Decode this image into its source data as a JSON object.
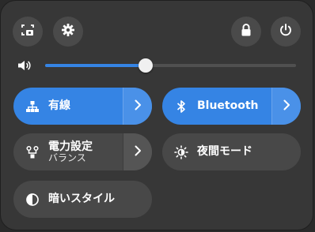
{
  "top_buttons": {
    "screenshot_icon": "screenshot-icon",
    "settings_icon": "gear-icon",
    "lock_icon": "lock-icon",
    "power_icon": "power-icon"
  },
  "volume": {
    "icon": "speaker-icon",
    "level_percent": 40
  },
  "tiles": {
    "network": {
      "label": "有線",
      "active": true,
      "icon": "network-wired-icon"
    },
    "bluetooth": {
      "label": "Bluetooth",
      "active": true,
      "icon": "bluetooth-icon"
    },
    "power_mode": {
      "label": "電力設定",
      "sublabel": "バランス",
      "active": false,
      "icon": "power-profile-icon"
    },
    "night_light": {
      "label": "夜間モード",
      "active": false,
      "icon": "night-light-icon"
    },
    "dark_style": {
      "label": "暗いスタイル",
      "active": false,
      "icon": "dark-style-icon"
    }
  },
  "colors": {
    "accent": "#3584e4",
    "panel_bg": "#373737",
    "tile_off": "#484848"
  }
}
